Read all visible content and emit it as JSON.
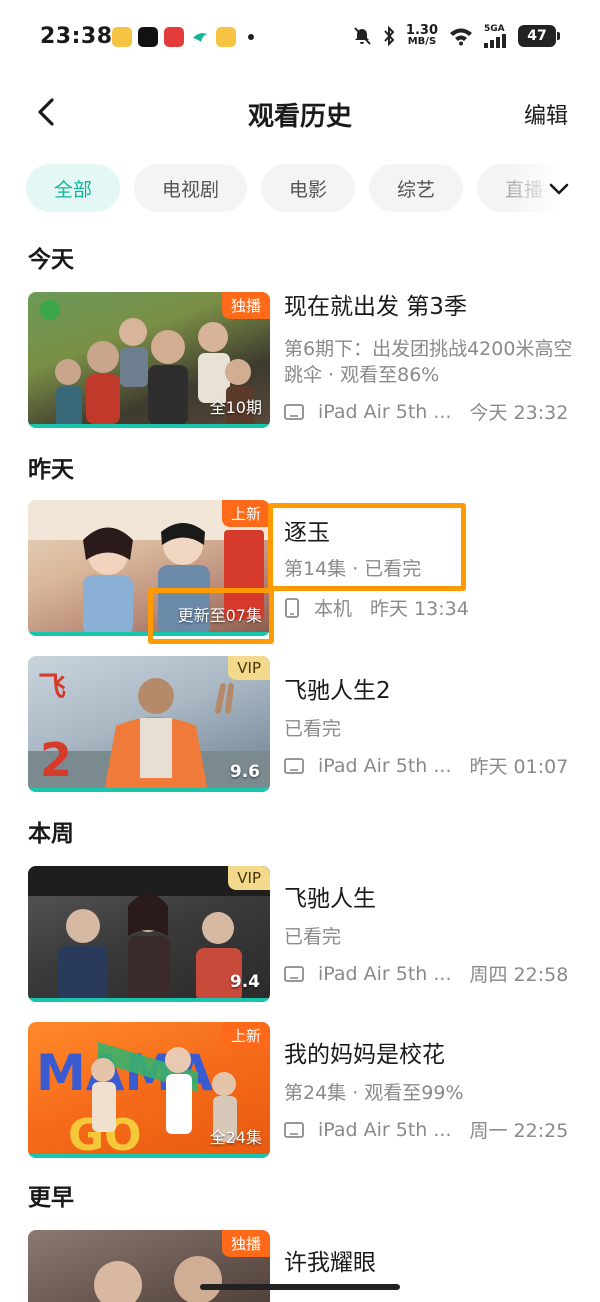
{
  "status_bar": {
    "time": "23:38",
    "net_speed_value": "1.30",
    "net_speed_unit": "MB/S",
    "network": "5GA",
    "battery": "47"
  },
  "header": {
    "title": "观看历史",
    "edit_label": "编辑"
  },
  "tabs": [
    "全部",
    "电视剧",
    "电影",
    "综艺",
    "直播"
  ],
  "sections": {
    "today": "今天",
    "yesterday": "昨天",
    "this_week": "本周",
    "earlier": "更早"
  },
  "items": [
    {
      "title": "现在就出发 第3季",
      "desc": "第6期下：出发团挑战4200米高空跳伞 · 观看至86%",
      "device": "iPad Air 5th ...",
      "time": "今天 23:32",
      "badge": "独播",
      "corner": "全10期"
    },
    {
      "title": "逐玉",
      "desc": "第14集 · 已看完",
      "device": "本机",
      "time": "昨天 13:34",
      "badge": "上新",
      "corner": "更新至07集"
    },
    {
      "title": "飞驰人生2",
      "desc": "已看完",
      "device": "iPad Air 5th ...",
      "time": "昨天 01:07",
      "badge": "VIP",
      "corner": "9.6"
    },
    {
      "title": "飞驰人生",
      "desc": "已看完",
      "device": "iPad Air 5th ...",
      "time": "周四 22:58",
      "badge": "VIP",
      "corner": "9.4"
    },
    {
      "title": "我的妈妈是校花",
      "desc": "第24集 · 观看至99%",
      "device": "iPad Air 5th ...",
      "time": "周一 22:25",
      "badge": "上新",
      "corner": "全24集"
    },
    {
      "title": "许我耀眼",
      "badge": "独播"
    }
  ],
  "colors": {
    "accent": "#12b59a",
    "highlight": "#ff9a00",
    "badge_orange": "#ff6a1a",
    "badge_vip": "#f2d98b"
  }
}
